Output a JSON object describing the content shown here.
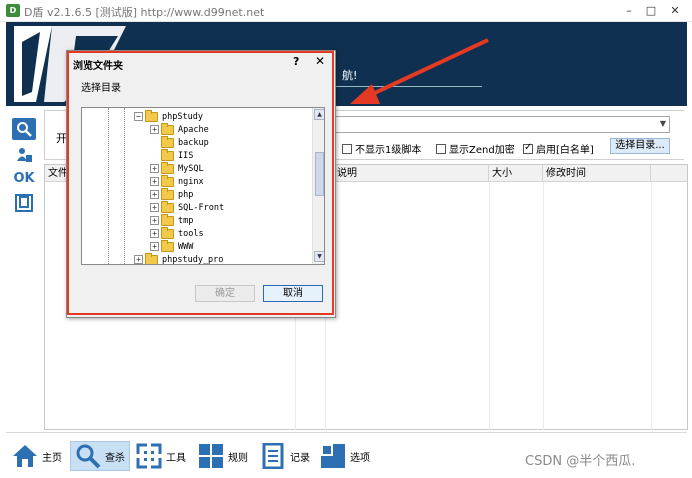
{
  "window": {
    "logo_text": "D",
    "title": "D盾 v2.1.6.5 [测试版] http://www.d99net.net",
    "minimize": "–",
    "maximize": "□",
    "close": "✕"
  },
  "banner": {
    "nav_text": "航!"
  },
  "left_icons": [
    {
      "icon": "search-icon",
      "glyph": "🔍"
    },
    {
      "icon": "user-shield-icon",
      "glyph": "♟"
    },
    {
      "icon": "ok-icon",
      "glyph": "OK"
    },
    {
      "icon": "frame-icon",
      "glyph": "⊔"
    }
  ],
  "scan": {
    "start_label": "开",
    "path_value": "",
    "options": [
      {
        "label": "不显示1级脚本",
        "checked": false
      },
      {
        "label": "显示Zend加密",
        "checked": false
      },
      {
        "label": "启用[白名单]",
        "checked": true
      }
    ],
    "select_dir_label": "选择目录..."
  },
  "file_list": {
    "columns": [
      "文件",
      "说明",
      "大小",
      "修改时间"
    ]
  },
  "toolbar": {
    "items": [
      {
        "label": "主页",
        "icon": "home-icon"
      },
      {
        "label": "查杀",
        "icon": "search-icon",
        "active": true
      },
      {
        "label": "工具",
        "icon": "tools-icon"
      },
      {
        "label": "规则",
        "icon": "rules-icon"
      },
      {
        "label": "记录",
        "icon": "log-icon"
      },
      {
        "label": "选项",
        "icon": "options-icon"
      }
    ]
  },
  "watermark": "CSDN @半个西瓜.",
  "dialog": {
    "title": "浏览文件夹",
    "help": "?",
    "close": "✕",
    "prompt": "选择目录",
    "tree": [
      {
        "label": "phpStudy",
        "level": 0,
        "expander": "⊟",
        "open": true
      },
      {
        "label": "Apache",
        "level": 1,
        "expander": "+"
      },
      {
        "label": "backup",
        "level": 1,
        "expander": ""
      },
      {
        "label": "IIS",
        "level": 1,
        "expander": ""
      },
      {
        "label": "MySQL",
        "level": 1,
        "expander": "+"
      },
      {
        "label": "nginx",
        "level": 1,
        "expander": "+"
      },
      {
        "label": "php",
        "level": 1,
        "expander": "+"
      },
      {
        "label": "SQL-Front",
        "level": 1,
        "expander": "+"
      },
      {
        "label": "tmp",
        "level": 1,
        "expander": "+"
      },
      {
        "label": "tools",
        "level": 1,
        "expander": "+"
      },
      {
        "label": "WWW",
        "level": 1,
        "expander": "+"
      },
      {
        "label": "phpstudy_pro",
        "level": 0,
        "expander": "+"
      }
    ],
    "ok_label": "确定",
    "cancel_label": "取消",
    "highlight_color": "#e43a24"
  },
  "annotation": {
    "arrow_color": "#e43a24"
  }
}
